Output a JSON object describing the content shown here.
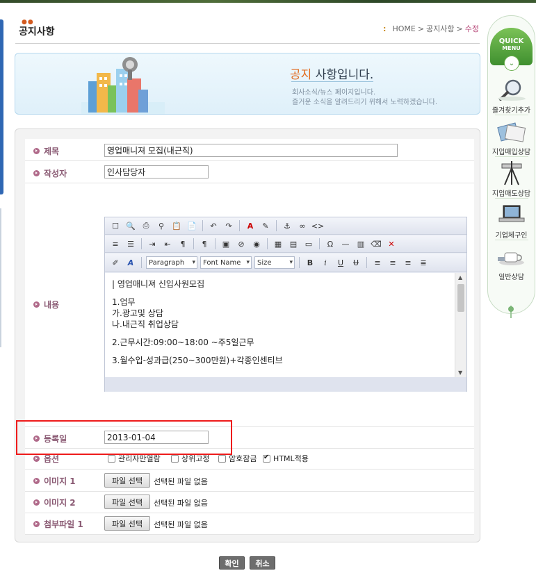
{
  "header": {
    "title": "공지사항",
    "breadcrumb": [
      "HOME",
      "공지사항",
      "수정"
    ]
  },
  "banner": {
    "headline_accent": "공지",
    "headline_rest": " 사항입니다.",
    "sub1": "회사소식/뉴스 페이지입니다.",
    "sub2": "즐거운 소식을 알려드리기 위해서 노력하겠습니다."
  },
  "form": {
    "subject_label": "제목",
    "subject_value": "영업매니져 모집(내근직)",
    "author_label": "작성자",
    "author_value": "인사담당자",
    "content_label": "내용",
    "date_label": "등록일",
    "date_value": "2013-01-04",
    "options_label": "옵션",
    "options": [
      {
        "label": "관리자만열람",
        "checked": false
      },
      {
        "label": "상위고정",
        "checked": false
      },
      {
        "label": "암호잠금",
        "checked": false
      },
      {
        "label": "HTML적용",
        "checked": true
      }
    ],
    "image1_label": "이미지 1",
    "image2_label": "이미지 2",
    "attach_label": "첨부파일 1",
    "file_button": "파일 선택",
    "no_file_text": "선택된 파일 없음"
  },
  "editor": {
    "format_select": "Paragraph",
    "font_select": "Font Name",
    "size_select": "Size",
    "lines": [
      "| 영업매니져 신입사원모집",
      "",
      "1.업무",
      "가.광고및 상담",
      "나.내근직 취업상담",
      "",
      "2.근무시간:09:00~18:00 ~주5일근무",
      "",
      "3.월수입-성과급(250~300만원)+각종인센티브"
    ]
  },
  "actions": {
    "confirm": "확인",
    "cancel": "취소"
  },
  "quick_menu": {
    "title1": "QUICK",
    "title2": "MENU",
    "items": [
      "즐겨찾기추가",
      "지입매입상담",
      "지입매도상담",
      "기업체구인",
      "일반상담"
    ]
  }
}
